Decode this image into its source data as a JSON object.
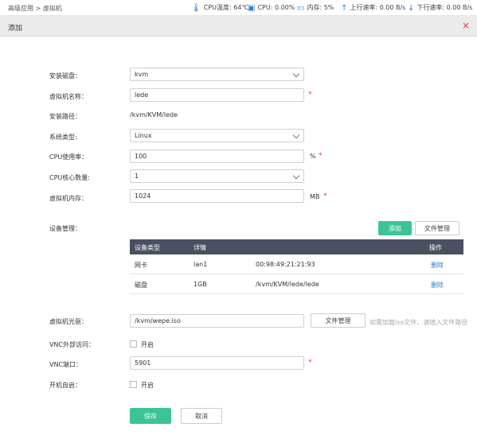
{
  "breadcrumb": {
    "parent": "高级应用",
    "sep": ">",
    "current": "虚拟机"
  },
  "status": {
    "cpu_temp": "CPU温度: 64℃",
    "cpu": "CPU: 0.00%",
    "mem": "内存: 5%",
    "up": "上行速率: 0.00 B/s",
    "down": "下行速率: 0.00 B/s"
  },
  "dialog": {
    "title": "添加",
    "close": "×"
  },
  "form": {
    "disk_label": "安装磁盘：",
    "disk_value": "kvm",
    "name_label": "虚拟机名称：",
    "name_value": "lede",
    "path_label": "安装路径：",
    "path_value": "/kvm/KVM/lede",
    "os_label": "系统类型:",
    "os_value": "Linux",
    "cpu_label": "CPU使用率：",
    "cpu_value": "100",
    "cpu_unit": "%",
    "cores_label": "CPU核心数量:",
    "cores_value": "1",
    "mem_label": "虚拟机内存：",
    "mem_value": "1024",
    "mem_unit": "MB",
    "device_label": "设备管理：",
    "add_button": "添加",
    "file_manage_button": "文件管理",
    "cdrom_label": "虚拟机光驱：",
    "cdrom_value": "/kvm/wepe.iso",
    "cdrom_file_button": "文件管理",
    "cdrom_hint": "如需加载iso文件，请填入文件路径",
    "vnc_ext_label": "VNC外部访问：",
    "vnc_ext_option": "开启",
    "vnc_port_label": "VNC端口：",
    "vnc_port_value": "5901",
    "autostart_label": "开机自启：",
    "autostart_option": "开启",
    "required_mark": "*",
    "save_button": "保存",
    "cancel_button": "取消"
  },
  "device_table": {
    "headers": [
      "设备类型",
      "详情",
      "操作"
    ],
    "rows": [
      {
        "type": "网卡",
        "detail1": "lan1",
        "detail2": "00:98:49:21:21:93",
        "action": "删除"
      },
      {
        "type": "磁盘",
        "detail1": "1GB",
        "detail2": "/kvm/KVM/lede/lede",
        "action": "删除"
      }
    ]
  },
  "colors": {
    "accent": "#3cc495",
    "link": "#2a7fd4",
    "required": "#e4393c",
    "table_head": "#4a5060"
  },
  "icons": [
    "thermometer-icon",
    "cpu-icon",
    "monitor-icon",
    "upload-arrow-icon",
    "download-arrow-icon",
    "close-icon"
  ]
}
